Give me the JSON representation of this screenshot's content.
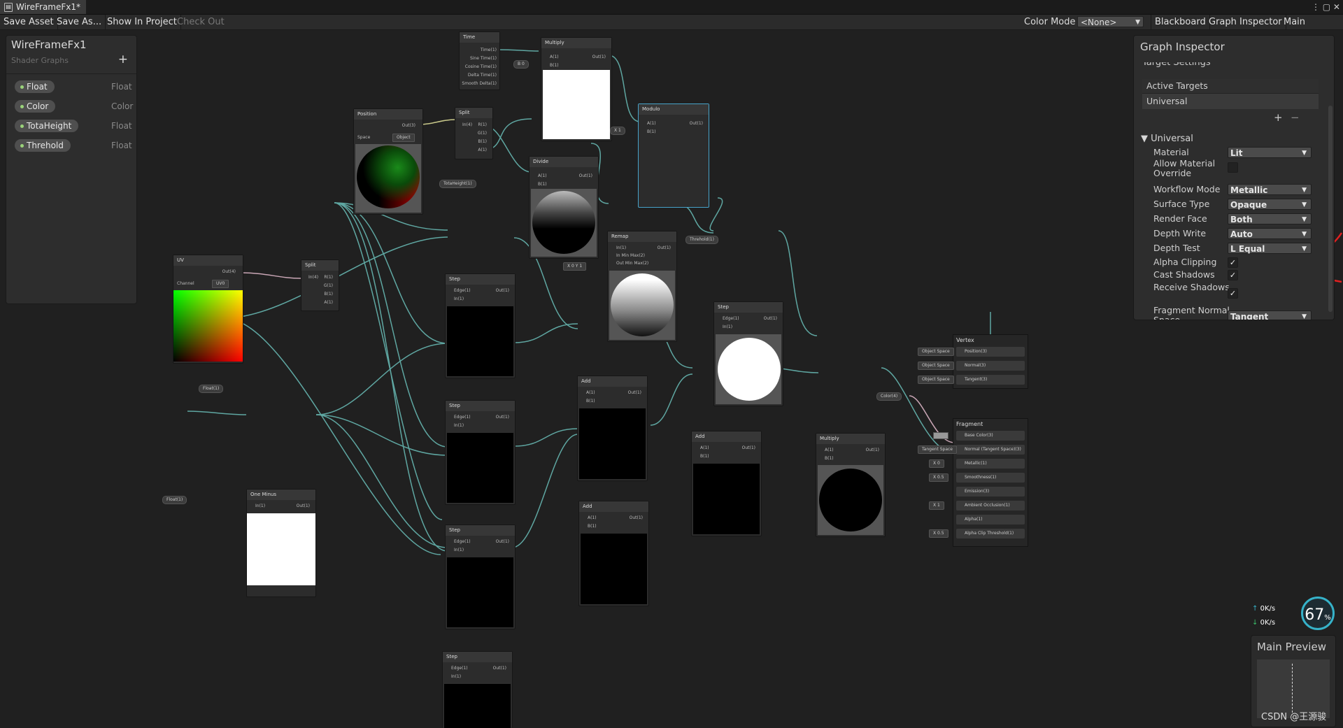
{
  "window": {
    "tab_title": "WireFrameFx1*",
    "controls": "⋮ ▢ ✕"
  },
  "toolbar": {
    "save_asset": "Save Asset",
    "save_as": "Save As...",
    "show_in_project": "Show In Project",
    "check_out": "Check Out",
    "color_mode_label": "Color Mode",
    "color_mode_value": "<None>",
    "blackboard": "Blackboard",
    "graph_inspector": "Graph Inspector",
    "main_preview": "Main Preview"
  },
  "blackboard": {
    "title": "WireFrameFx1",
    "subtitle": "Shader Graphs",
    "add": "+",
    "properties": [
      {
        "name": "Float",
        "type": "Float"
      },
      {
        "name": "Color",
        "type": "Color"
      },
      {
        "name": "TotaHeight",
        "type": "Float"
      },
      {
        "name": "Threhold",
        "type": "Float"
      }
    ]
  },
  "nodes": {
    "time": {
      "title": "Time",
      "ports": [
        "Time(1)",
        "Sine Time(1)",
        "Cosine Time(1)",
        "Delta Time(1)",
        "Smooth Delta(1)"
      ]
    },
    "multiply1": {
      "title": "Multiply",
      "in": [
        "A(1)",
        "B(1)"
      ],
      "out": "Out(1)",
      "b_value": "B 0"
    },
    "modulo": {
      "title": "Modulo",
      "in": [
        "A(1)",
        "B(1)"
      ],
      "out": "Out(1)",
      "b_value": "X 1"
    },
    "position": {
      "title": "Position",
      "out": "Out(3)",
      "space_label": "Space",
      "space_value": "Object"
    },
    "split1": {
      "title": "Split",
      "in": "In(4)",
      "out": [
        "R(1)",
        "G(1)",
        "B(1)",
        "A(1)"
      ]
    },
    "divide": {
      "title": "Divide",
      "in": [
        "A(1)",
        "B(1)"
      ],
      "out": "Out(1)"
    },
    "totaheight_pill": "TotaHeight(1)",
    "remap": {
      "title": "Remap",
      "in": [
        "In(1)",
        "In Min Max(2)",
        "Out Min Max(2)"
      ],
      "out": "Out(1)",
      "values": "X 0   Y 1"
    },
    "threhold_pill": "Threhold(1)",
    "step_top": {
      "title": "Step",
      "in": [
        "Edge(1)",
        "In(1)"
      ],
      "out": "Out(1)"
    },
    "uv": {
      "title": "UV",
      "out": "Out(4)",
      "channel_label": "Channel",
      "channel_value": "UV0"
    },
    "split2": {
      "title": "Split",
      "in": "In(4)",
      "out": [
        "R(1)",
        "G(1)",
        "B(1)",
        "A(1)"
      ]
    },
    "float_pill": "Float(1)",
    "float_pill2": "Float(1)",
    "step": {
      "title": "Step",
      "in": [
        "Edge(1)",
        "In(1)"
      ],
      "out": "Out(1)"
    },
    "add": {
      "title": "Add",
      "in": [
        "A(1)",
        "B(1)"
      ],
      "out": "Out(1)"
    },
    "one_minus": {
      "title": "One Minus",
      "in": "In(1)",
      "out": "Out(1)"
    },
    "multiply2": {
      "title": "Multiply",
      "in": [
        "A(1)",
        "B(1)"
      ],
      "out": "Out(1)"
    },
    "color_pill": "Color(4)"
  },
  "master": {
    "vertex_title": "Vertex",
    "vertex_slots": [
      {
        "label": "Position(3)",
        "tag": "Object Space"
      },
      {
        "label": "Normal(3)",
        "tag": "Object Space"
      },
      {
        "label": "Tangent(3)",
        "tag": "Object Space"
      }
    ],
    "fragment_title": "Fragment",
    "fragment_slots": [
      {
        "label": "Base Color(3)",
        "tag": ""
      },
      {
        "label": "Normal (Tangent Space)(3)",
        "tag": "Tangent Space"
      },
      {
        "label": "Metallic(1)",
        "tag": "X 0"
      },
      {
        "label": "Smoothness(1)",
        "tag": "X 0.5"
      },
      {
        "label": "Emission(3)",
        "tag": ""
      },
      {
        "label": "Ambient Occlusion(1)",
        "tag": "X 1"
      },
      {
        "label": "Alpha(1)",
        "tag": ""
      },
      {
        "label": "Alpha Clip Threshold(1)",
        "tag": "X 0.5"
      }
    ]
  },
  "inspector": {
    "title": "Graph Inspector",
    "target_settings": "Target Settings",
    "active_targets": "Active Targets",
    "universal_item": "Universal",
    "plus": "+",
    "minus": "−",
    "section": "▼ Universal",
    "material_label": "Material",
    "material_value": "Lit",
    "allow_override_label": "Allow Material Override",
    "workflow_label": "Workflow Mode",
    "workflow_value": "Metallic",
    "surface_label": "Surface Type",
    "surface_value": "Opaque",
    "render_face_label": "Render Face",
    "render_face_value": "Both",
    "depth_write_label": "Depth Write",
    "depth_write_value": "Auto",
    "depth_test_label": "Depth Test",
    "depth_test_value": "L Equal",
    "alpha_clip_label": "Alpha Clipping",
    "cast_shadows_label": "Cast Shadows",
    "receive_shadows_label": "Receive Shadows",
    "frag_normal_label": "Fragment Normal Space",
    "frag_normal_value": "Tangent",
    "check": "✓"
  },
  "gauge": {
    "up": "0K/s",
    "down": "0K/s",
    "percent": "67",
    "unit": "%"
  },
  "main_preview": {
    "title": "Main Preview"
  },
  "watermark": "CSDN @王源骏",
  "colors": {
    "wire": "#5fa7a2",
    "wire_pink": "#c9a6b5",
    "wire_yellow": "#c8c88a",
    "accent": "#47a3c9",
    "arrow": "#e02020"
  }
}
